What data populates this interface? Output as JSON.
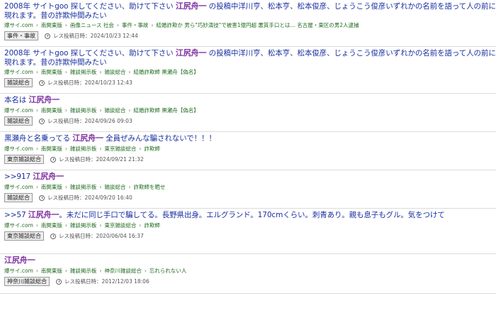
{
  "date_prefix": "レス投稿日時：",
  "sep": "›",
  "posts": [
    {
      "title_pre": "2008年 サイトgoo 探してください、助けて下さい ",
      "title_hl": "江尻舟一",
      "title_post": " の投稿中洋川亨、松本亨、松本俊彦、じょうこう俊彦いずれかの名前を語って人の前に現れます。昔の詐欺仲間みたい",
      "crumbs": [
        "爆サイ.com",
        "南関東版",
        "画像ニュース 社会",
        "事件・事故",
        "結婚詐欺か 男ら\"巧妙演技\"で被害1億円超 悪質手口とは… 名古屋・東区の男2人逮捕"
      ],
      "badge": "事件・事故",
      "date": "2024/10/23 12:44"
    },
    {
      "title_pre": "2008年 サイトgoo 探してください、助けて下さい ",
      "title_hl": "江尻舟一",
      "title_post": " の投稿中洋川亨、松本亨、松本俊彦、じょうこう俊彦いずれかの名前を語って人の前に現れます。昔の詐欺仲間みたい",
      "crumbs": [
        "爆サイ.com",
        "南関東版",
        "雑談掲示板",
        "雑談総合",
        "結婚詐欺師 黒瀬舟【偽名】"
      ],
      "badge": "雑談総合",
      "date": "2024/10/23 12:43"
    },
    {
      "title_pre": "本名は ",
      "title_hl": "江尻舟一",
      "title_post": "",
      "crumbs": [
        "爆サイ.com",
        "南関東版",
        "雑談掲示板",
        "雑談総合",
        "結婚詐欺師 黒瀬舟【偽名】"
      ],
      "badge": "雑談総合",
      "date": "2024/09/26 09:03"
    },
    {
      "title_pre": "黒瀬舟と名乗ってる ",
      "title_hl": "江尻舟一",
      "title_post": " 全員ぜみんな騙されないで！！！",
      "crumbs": [
        "爆サイ.com",
        "南関東版",
        "雑談掲示板",
        "東京雑談総合",
        "詐欺師"
      ],
      "badge": "東京雑談総合",
      "date": "2024/09/21 21:32"
    },
    {
      "title_pre": ">>917 ",
      "title_hl": "江尻舟一",
      "title_post": "",
      "crumbs": [
        "爆サイ.com",
        "南関東版",
        "雑談掲示板",
        "雑談総合",
        "詐欺師を晒せ"
      ],
      "badge": "雑談総合",
      "date": "2024/09/20 16:40"
    },
    {
      "title_pre": ">>57 ",
      "title_hl": "江尻舟一",
      "title_post": "。未だに同じ手口で騙してる。長野県出身。エルグランド。170cmくらい。刺青あり。親も息子もグル。気をつけて",
      "crumbs": [
        "爆サイ.com",
        "南関東版",
        "雑談掲示板",
        "東京雑談総合",
        "詐欺師"
      ],
      "badge": "東京雑談総合",
      "date": "2020/06/04 16:37"
    },
    {
      "title_pre": "",
      "title_hl": "江尻舟一",
      "title_post": "",
      "crumbs": [
        "爆サイ.com",
        "南関東版",
        "雑談掲示板",
        "神奈川雑談総合",
        "忘れられない人"
      ],
      "badge": "神奈川雑談総合",
      "date": "2012/12/03 18:06"
    }
  ]
}
